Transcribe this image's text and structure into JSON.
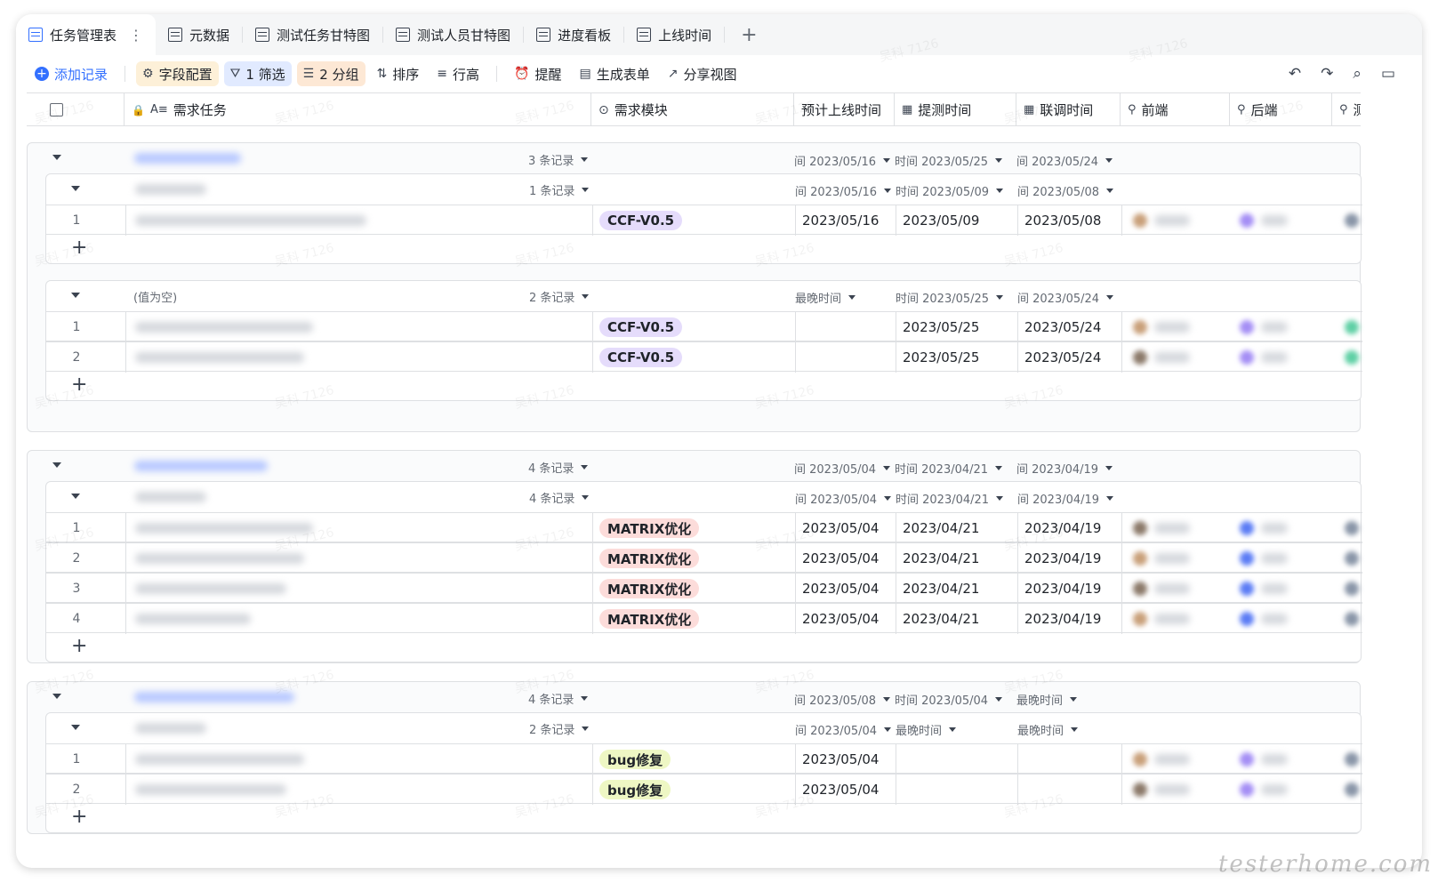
{
  "tabs": [
    {
      "label": "任务管理表",
      "active": true
    },
    {
      "label": "元数据"
    },
    {
      "label": "测试任务甘特图"
    },
    {
      "label": "测试人员甘特图"
    },
    {
      "label": "进度看板"
    },
    {
      "label": "上线时间"
    }
  ],
  "toolbar": {
    "add": "添加记录",
    "fields": "字段配置",
    "filter": "1 筛选",
    "group": "2 分组",
    "sort": "排序",
    "row_height": "行高",
    "remind": "提醒",
    "form": "生成表单",
    "share": "分享视图"
  },
  "columns": {
    "task": "需求任务",
    "module": "需求模块",
    "release": "预计上线时间",
    "submit": "提测时间",
    "joint": "联调时间",
    "frontend": "前端",
    "backend": "后端",
    "test": "测"
  },
  "groups": [
    {
      "count": "3 条记录",
      "release": "间 2023/05/16",
      "submit": "时间 2023/05/25",
      "joint": "间 2023/05/24",
      "subgroups": [
        {
          "count": "1 条记录",
          "release": "间 2023/05/16",
          "submit": "时间 2023/05/09",
          "joint": "间 2023/05/08",
          "rows": [
            {
              "num": "1",
              "module": "CCF-V0.5",
              "release": "2023/05/16",
              "submit": "2023/05/09",
              "joint": "2023/05/08"
            }
          ]
        },
        {
          "label": "(值为空)",
          "count": "2 条记录",
          "release": "最晚时间",
          "submit": "时间 2023/05/25",
          "joint": "间 2023/05/24",
          "rows": [
            {
              "num": "1",
              "module": "CCF-V0.5",
              "release": "",
              "submit": "2023/05/25",
              "joint": "2023/05/24"
            },
            {
              "num": "2",
              "module": "CCF-V0.5",
              "release": "",
              "submit": "2023/05/25",
              "joint": "2023/05/24"
            }
          ]
        }
      ]
    },
    {
      "count": "4 条记录",
      "release": "间 2023/05/04",
      "submit": "时间 2023/04/21",
      "joint": "间 2023/04/19",
      "subgroups": [
        {
          "count": "4 条记录",
          "release": "间 2023/05/04",
          "submit": "时间 2023/04/21",
          "joint": "间 2023/04/19",
          "rows": [
            {
              "num": "1",
              "module": "MATRIX优化",
              "release": "2023/05/04",
              "submit": "2023/04/21",
              "joint": "2023/04/19"
            },
            {
              "num": "2",
              "module": "MATRIX优化",
              "release": "2023/05/04",
              "submit": "2023/04/21",
              "joint": "2023/04/19"
            },
            {
              "num": "3",
              "module": "MATRIX优化",
              "release": "2023/05/04",
              "submit": "2023/04/21",
              "joint": "2023/04/19"
            },
            {
              "num": "4",
              "module": "MATRIX优化",
              "release": "2023/05/04",
              "submit": "2023/04/21",
              "joint": "2023/04/19"
            }
          ]
        }
      ]
    },
    {
      "count": "4 条记录",
      "release": "间 2023/05/08",
      "submit": "时间 2023/05/04",
      "joint": "最晚时间",
      "subgroups": [
        {
          "count": "2 条记录",
          "release": "间 2023/05/04",
          "submit": "最晚时间",
          "joint": "最晚时间",
          "rows": [
            {
              "num": "1",
              "module": "bug修复",
              "release": "2023/05/04",
              "submit": "",
              "joint": ""
            },
            {
              "num": "2",
              "module": "bug修复",
              "release": "2023/05/04",
              "submit": "",
              "joint": ""
            }
          ]
        }
      ]
    }
  ],
  "module_colors": {
    "CCF-V0.5": {
      "bg": "#e5dcfb",
      "fg": "#1f2329"
    },
    "MATRIX优化": {
      "bg": "#fcdcda",
      "fg": "#1f2329"
    },
    "bug修复": {
      "bg": "#eef7c4",
      "fg": "#1f2329"
    }
  },
  "watermark": "吴科 7126",
  "site_mark": "testerhome.com"
}
